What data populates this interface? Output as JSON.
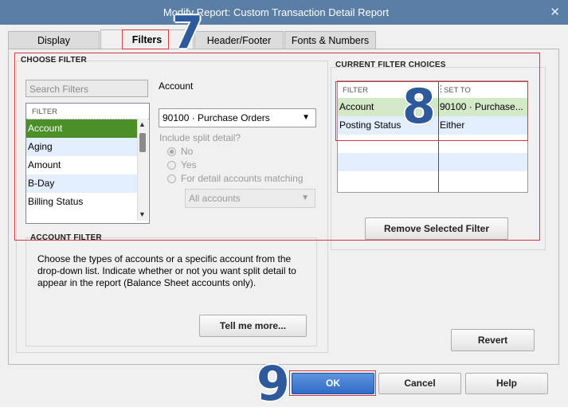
{
  "window": {
    "title": "Modify Report: Custom Transaction Detail Report",
    "close_glyph": "✕"
  },
  "tabs": [
    {
      "label": "Display"
    },
    {
      "label": "Filters"
    },
    {
      "label": "Header/Footer"
    },
    {
      "label": "Fonts & Numbers"
    }
  ],
  "choose_filter": {
    "heading": "CHOOSE FILTER",
    "search_placeholder": "Search Filters",
    "list_header": "FILTER",
    "items": [
      "Account",
      "Aging",
      "Amount",
      "B-Day",
      "Billing Status"
    ],
    "selected": "Account"
  },
  "account": {
    "label": "Account",
    "dropdown_value": "90100 · Purchase Orders",
    "split_label": "Include split detail?",
    "options": [
      "No",
      "Yes",
      "For detail accounts matching"
    ],
    "selected_option": "No",
    "accounts_value": "All accounts"
  },
  "account_filter": {
    "heading": "ACCOUNT FILTER",
    "description": "Choose the types of accounts or a specific account from the drop-down list. Indicate whether or not you want split detail to appear in the report (Balance Sheet accounts only).",
    "tell_more": "Tell me more..."
  },
  "current_filters": {
    "heading": "CURRENT FILTER CHOICES",
    "col_filter": "FILTER",
    "col_set_to": "SET TO",
    "rows": [
      {
        "filter": "Account",
        "set_to": "90100 · Purchase..."
      },
      {
        "filter": "Posting Status",
        "set_to": "Either"
      }
    ],
    "remove_button": "Remove Selected Filter"
  },
  "buttons": {
    "revert": "Revert",
    "ok": "OK",
    "cancel": "Cancel",
    "help": "Help"
  },
  "annotations": {
    "seven": "7",
    "eight": "8",
    "nine": "9",
    "accent_color": "#d9363e",
    "number_color": "#2e5a9b"
  }
}
